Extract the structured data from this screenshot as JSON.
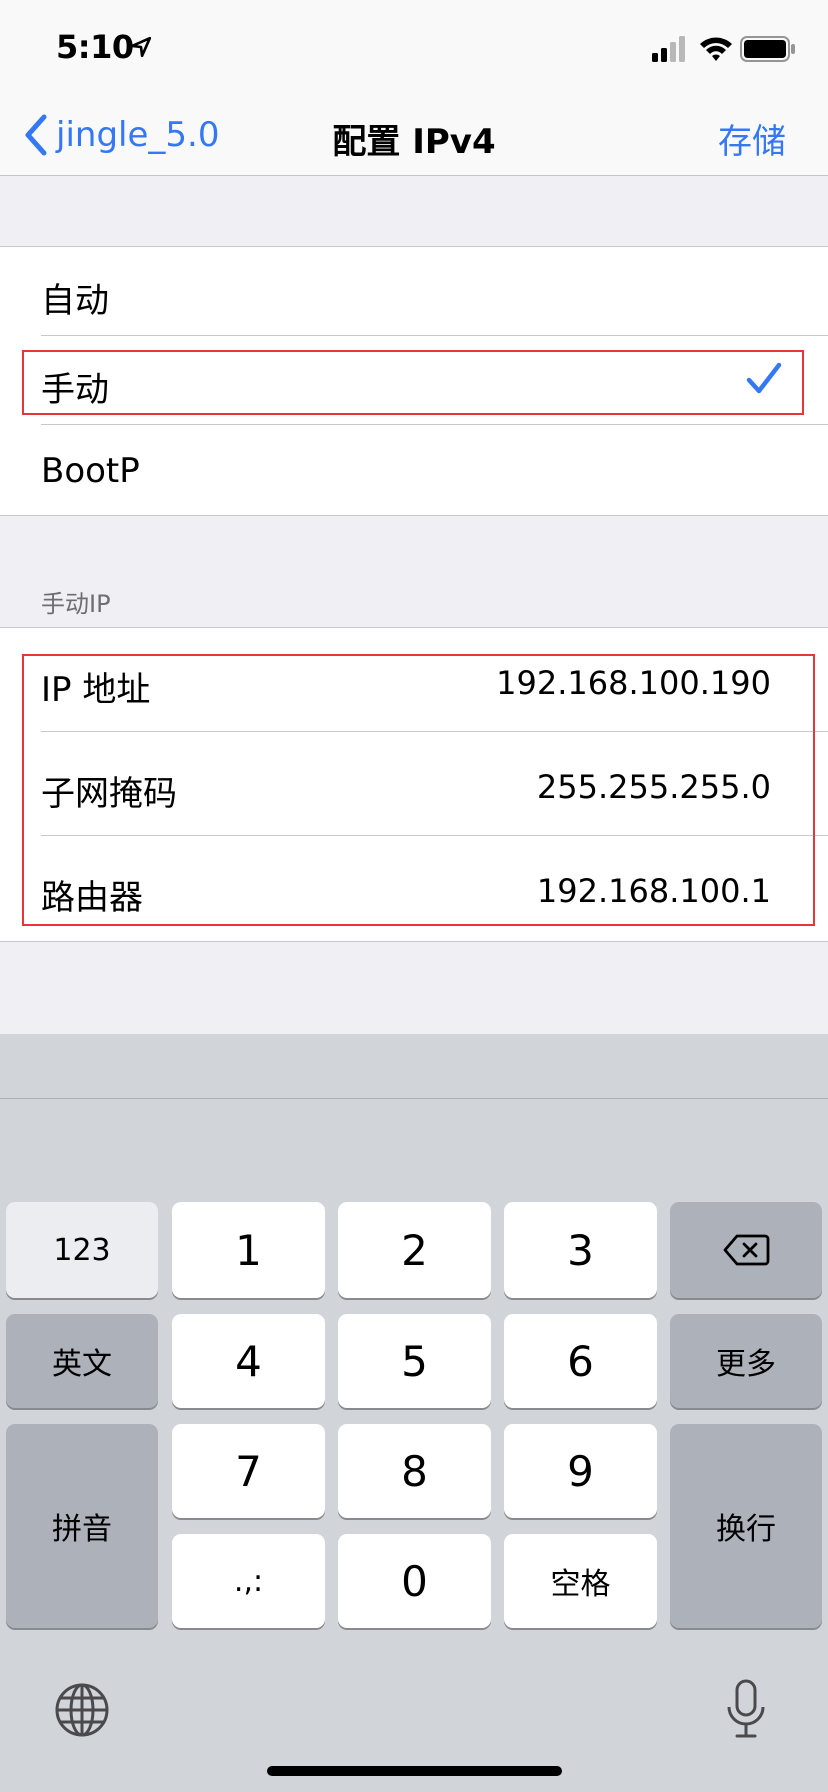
{
  "status_bar": {
    "time": "5:10"
  },
  "nav": {
    "back_label": "jingle_5.0",
    "title": "配置 IPv4",
    "save_label": "存储"
  },
  "config_options": [
    {
      "label": "自动",
      "selected": false
    },
    {
      "label": "手动",
      "selected": true
    },
    {
      "label": "BootP",
      "selected": false
    }
  ],
  "manual_ip": {
    "header": "手动IP",
    "rows": [
      {
        "label": "IP 地址",
        "value": "192.168.100.190"
      },
      {
        "label": "子网掩码",
        "value": "255.255.255.0"
      },
      {
        "label": "路由器",
        "value": "192.168.100.1"
      }
    ]
  },
  "keyboard": {
    "key_123": "123",
    "key_1": "1",
    "key_2": "2",
    "key_3": "3",
    "key_english": "英文",
    "key_4": "4",
    "key_5": "5",
    "key_6": "6",
    "key_more": "更多",
    "key_pinyin": "拼音",
    "key_7": "7",
    "key_8": "8",
    "key_9": "9",
    "key_return": "换行",
    "key_punct": ".,:",
    "key_0": "0",
    "key_space": "空格"
  },
  "colors": {
    "accent": "#3478f6",
    "highlight": "#e8353b"
  }
}
